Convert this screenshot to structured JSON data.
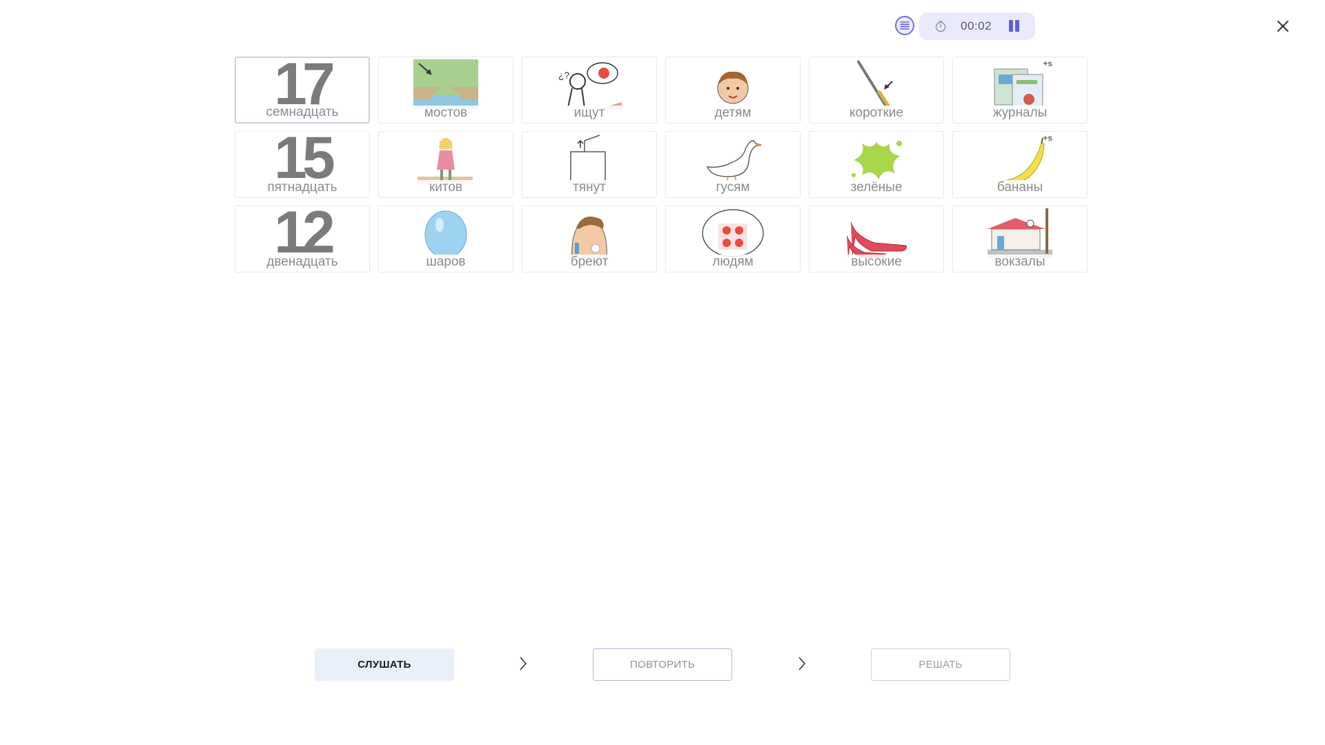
{
  "topbar": {
    "timer": "00:02",
    "icons": {
      "list": "list-icon",
      "timer": "stopwatch-icon",
      "pause": "pause-icon",
      "close": "close-icon"
    },
    "accent": "#5e62cf"
  },
  "grid": {
    "rows": [
      [
        {
          "label": "семнадцать",
          "number": "17",
          "selected": true
        },
        {
          "label": "мостов",
          "image": "bridge-image"
        },
        {
          "label": "ищут",
          "image": "search-image"
        },
        {
          "label": "детям",
          "image": "child-image"
        },
        {
          "label": "короткие",
          "image": "pencils-image"
        },
        {
          "label": "журналы",
          "image": "magazines-image",
          "badge": "+s"
        }
      ],
      [
        {
          "label": "пятнадцать",
          "number": "15"
        },
        {
          "label": "китов",
          "image": "girl-image"
        },
        {
          "label": "тянут",
          "image": "pull-image"
        },
        {
          "label": "гусям",
          "image": "goose-image"
        },
        {
          "label": "зелёные",
          "image": "green-splash-image"
        },
        {
          "label": "бананы",
          "image": "banana-image",
          "badge": "+s"
        }
      ],
      [
        {
          "label": "двенадцать",
          "number": "12"
        },
        {
          "label": "шаров",
          "image": "balloon-image"
        },
        {
          "label": "бреют",
          "image": "shaving-image"
        },
        {
          "label": "людям",
          "image": "people-image"
        },
        {
          "label": "высокие",
          "image": "high-heels-image"
        },
        {
          "label": "вокзалы",
          "image": "station-image"
        }
      ]
    ]
  },
  "steps": {
    "listen": "СЛУШАТЬ",
    "repeat": "ПОВТОРИТЬ",
    "solve": "РЕШАТЬ",
    "chevron": "chevron-right-icon"
  }
}
